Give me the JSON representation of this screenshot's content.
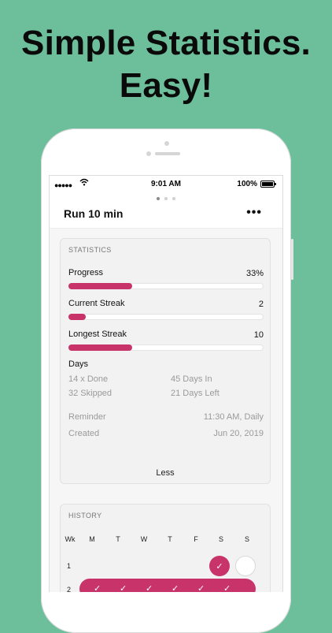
{
  "promo": {
    "headline_line1": "Simple Statistics.",
    "headline_line2": "Easy!"
  },
  "status_bar": {
    "signal": "●●●●●",
    "time": "9:01 AM",
    "battery": "100%"
  },
  "nav": {
    "title": "Run 10 min",
    "more_label": "•••"
  },
  "statistics": {
    "section_title": "STATISTICS",
    "progress": {
      "label": "Progress",
      "value": "33%",
      "fraction": 0.33
    },
    "current_streak": {
      "label": "Current Streak",
      "value": "2",
      "fraction": 0.09
    },
    "longest_streak": {
      "label": "Longest Streak",
      "value": "10",
      "fraction": 0.33
    },
    "days": {
      "title": "Days",
      "done": "14 x Done",
      "days_in": "45 Days In",
      "skipped": "32 Skipped",
      "days_left": "21 Days Left"
    },
    "reminder_label": "Reminder",
    "reminder_value": "11:30 AM, Daily",
    "created_label": "Created",
    "created_value": "Jun 20, 2019",
    "less_label": "Less"
  },
  "history": {
    "section_title": "HISTORY",
    "columns": [
      "Wk",
      "M",
      "T",
      "W",
      "T",
      "F",
      "S",
      "S"
    ],
    "weeks": [
      "1",
      "2"
    ],
    "check": "✓"
  },
  "colors": {
    "background": "#6dbf9c",
    "accent": "#c8336a"
  }
}
